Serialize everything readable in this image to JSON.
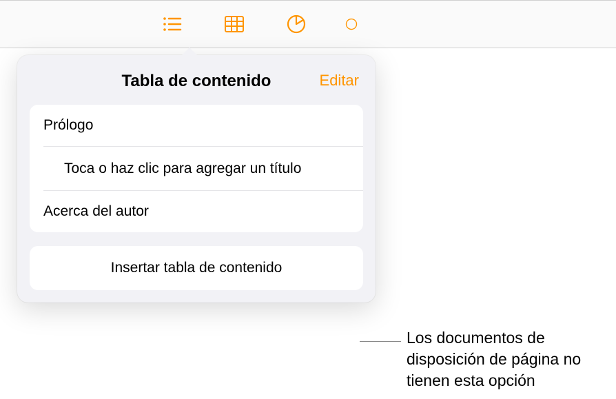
{
  "colors": {
    "accent": "#ff9500"
  },
  "toolbar": {
    "icons": [
      "list-icon",
      "table-icon",
      "chart-icon",
      "shape-icon"
    ]
  },
  "popover": {
    "title": "Tabla de contenido",
    "edit_label": "Editar",
    "toc_items": [
      {
        "label": "Prólogo",
        "indented": false
      },
      {
        "label": "Toca o haz clic para agregar un título",
        "indented": true
      },
      {
        "label": "Acerca del autor",
        "indented": false
      }
    ],
    "insert_label": "Insertar tabla de contenido"
  },
  "callout": {
    "text": "Los documentos de disposición de página no tienen esta opción"
  }
}
